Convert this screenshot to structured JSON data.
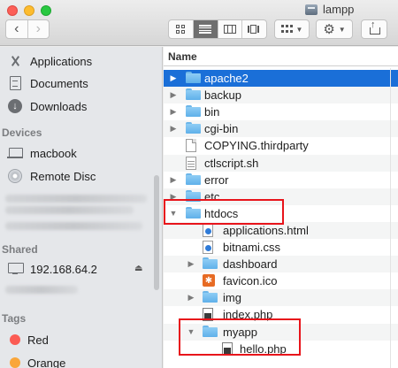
{
  "window": {
    "title": "lampp"
  },
  "toolbar": {
    "back_symbol": "‹",
    "forward_symbol": "›",
    "views": [
      "icon-view",
      "list-view",
      "column-view",
      "cover-flow-view"
    ],
    "active_view": "list-view",
    "action_symbol": "⚙",
    "dropdown_symbol": "▼"
  },
  "sidebar": {
    "favorites": [
      {
        "label": "Applications",
        "icon": "applications-icon"
      },
      {
        "label": "Documents",
        "icon": "documents-icon"
      },
      {
        "label": "Downloads",
        "icon": "downloads-icon"
      }
    ],
    "devices_heading": "Devices",
    "devices": [
      {
        "label": "macbook",
        "icon": "laptop-icon"
      },
      {
        "label": "Remote Disc",
        "icon": "disc-icon"
      }
    ],
    "shared_heading": "Shared",
    "shared": [
      {
        "label": "192.168.64.2",
        "icon": "monitor-icon",
        "eject": "⏏"
      }
    ],
    "tags_heading": "Tags",
    "tags": [
      {
        "label": "Red",
        "color": "#fb5b53"
      },
      {
        "label": "Orange",
        "color": "#f9a63a"
      }
    ]
  },
  "file_list": {
    "column_header": "Name",
    "rows": [
      {
        "name": "apache2",
        "type": "folder",
        "depth": 0,
        "expander": "▶",
        "selected": true
      },
      {
        "name": "backup",
        "type": "folder",
        "depth": 0,
        "expander": "▶"
      },
      {
        "name": "bin",
        "type": "folder",
        "depth": 0,
        "expander": "▶"
      },
      {
        "name": "cgi-bin",
        "type": "folder",
        "depth": 0,
        "expander": "▶"
      },
      {
        "name": "COPYING.thirdparty",
        "type": "document",
        "depth": 0
      },
      {
        "name": "ctlscript.sh",
        "type": "script",
        "depth": 0
      },
      {
        "name": "error",
        "type": "folder",
        "depth": 0,
        "expander": "▶"
      },
      {
        "name": "etc",
        "type": "folder",
        "depth": 0,
        "expander": "▶"
      },
      {
        "name": "htdocs",
        "type": "folder",
        "depth": 0,
        "expander": "▼"
      },
      {
        "name": "applications.html",
        "type": "html",
        "depth": 1
      },
      {
        "name": "bitnami.css",
        "type": "css",
        "depth": 1
      },
      {
        "name": "dashboard",
        "type": "folder",
        "depth": 1,
        "expander": "▶"
      },
      {
        "name": "favicon.ico",
        "type": "ico",
        "depth": 1
      },
      {
        "name": "img",
        "type": "folder",
        "depth": 1,
        "expander": "▶"
      },
      {
        "name": "index.php",
        "type": "php",
        "depth": 1
      },
      {
        "name": "myapp",
        "type": "folder",
        "depth": 1,
        "expander": "▼"
      },
      {
        "name": "hello.php",
        "type": "php",
        "depth": 2
      }
    ]
  },
  "colors": {
    "selection": "#1a6fd8",
    "highlight_box": "#e8141b",
    "folder": "#6cb6e9"
  }
}
